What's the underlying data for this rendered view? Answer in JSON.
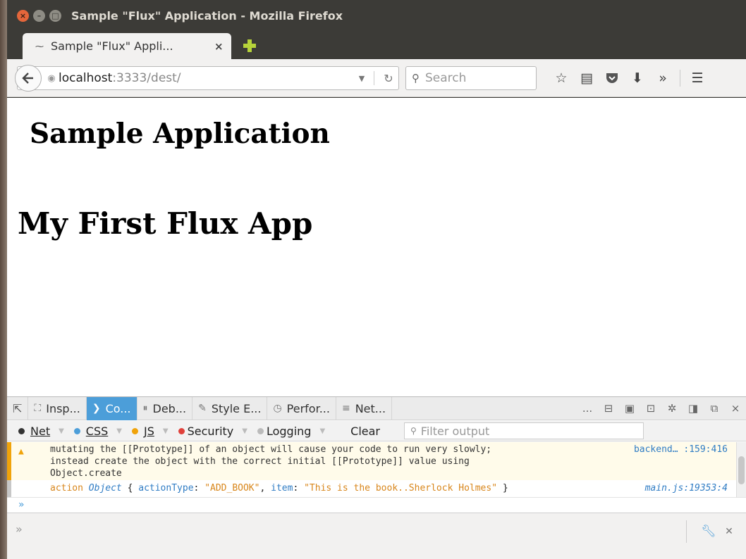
{
  "window": {
    "title": "Sample \"Flux\" Application - Mozilla Firefox",
    "buttons": {
      "close": "×",
      "minimize": "–",
      "maximize": "□"
    }
  },
  "tabs": [
    {
      "title": "Sample \"Flux\" Appli...",
      "close": "×",
      "favicon": "favicon-icon"
    }
  ],
  "navbar": {
    "url_host": "localhost",
    "url_rest": ":3333/dest/",
    "search_placeholder": "Search"
  },
  "page": {
    "heading1": "Sample Application",
    "heading2": "My First Flux App"
  },
  "devtools": {
    "tabs": [
      {
        "label": "Insp...",
        "icon": "inspector-icon",
        "glyph": "⛶",
        "active": false
      },
      {
        "label": "Co...",
        "icon": "console-icon",
        "glyph": "❯",
        "active": true
      },
      {
        "label": "Deb...",
        "icon": "debugger-icon",
        "glyph": "⏸",
        "active": false
      },
      {
        "label": "Style E...",
        "icon": "style-editor-icon",
        "glyph": "✎",
        "active": false
      },
      {
        "label": "Perfor...",
        "icon": "performance-icon",
        "glyph": "◷",
        "active": false
      },
      {
        "label": "Net...",
        "icon": "network-icon",
        "glyph": "≡",
        "active": false
      }
    ],
    "more_label": "...",
    "filters": [
      {
        "label": "Net",
        "color": "#333333"
      },
      {
        "label": "CSS",
        "color": "#4c9ed9"
      },
      {
        "label": "JS",
        "color": "#f0a30a"
      },
      {
        "label": "Security",
        "color": "#e0413b"
      },
      {
        "label": "Logging",
        "color": "#bbbbbb"
      }
    ],
    "clear_label": "Clear",
    "filter_placeholder": "Filter output",
    "messages": {
      "warning": {
        "text": "mutating the [[Prototype]] of an object will cause your code to run very slowly;\ninstead create the object with the correct initial [[Prototype]] value using\nObject.create",
        "location": "backend… :159:416"
      },
      "log": {
        "label": "action",
        "object": "Object",
        "key1": "actionType",
        "value1": "\"ADD_BOOK\"",
        "key2": "item",
        "value2": "\"This is the book..Sherlock Holmes\"",
        "location": "main.js:19353:4"
      }
    },
    "prompt": "»",
    "addon_prompt": "»"
  },
  "colors": {
    "accent": "#4c9ed9",
    "warning": "#f0a30a",
    "titlebar": "#3c3b37"
  }
}
